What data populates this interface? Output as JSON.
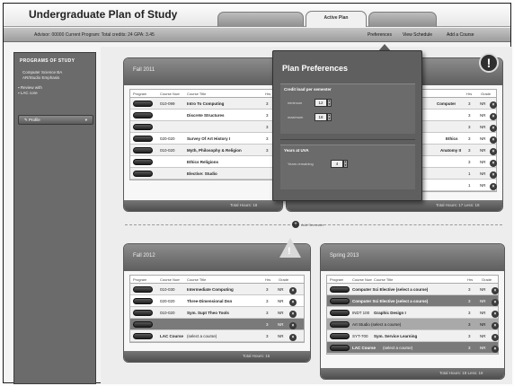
{
  "app": {
    "title": "Undergraduate Plan of Study",
    "tabs": [
      {
        "label": ""
      },
      {
        "label": "Active Plan"
      },
      {
        "label": ""
      }
    ],
    "info": "Advisor: 00000   Current Program: Total credits: 24   GPA: 3.45",
    "nav": {
      "preferences": "Preferences",
      "view_schedule": "View Schedule",
      "add_course": "Add a Course"
    }
  },
  "sidebar": {
    "title": "PROGRAMS OF STUDY",
    "lines": [
      "Computer Science BA",
      "AR/Studio Emphasis"
    ],
    "bullets": [
      "Review with",
      "LAC core"
    ],
    "button_label": "Profile",
    "button_chevron": "▾"
  },
  "panels": {
    "top_left": {
      "name": "Fall 2011",
      "headers": [
        "Program",
        "Course Num",
        "Course Title",
        "Hrs"
      ],
      "rows": [
        {
          "num": "010-099",
          "title": "Intro To Computing",
          "hrs": "3"
        },
        {
          "num": "",
          "title": "Discrete Structures",
          "hrs": "3"
        },
        {
          "num": "",
          "title": "",
          "hrs": "3"
        },
        {
          "num": "020-020",
          "title": "Survey Of Art History I",
          "hrs": "3"
        },
        {
          "num": "010-020",
          "title": "Myth, Philosophy & Religion",
          "hrs": "3"
        },
        {
          "num": "",
          "title": "Ethics Religions",
          "hrs": ""
        },
        {
          "num": "",
          "title": "Elective: Studio",
          "hrs": ""
        }
      ],
      "footer": "Total Hours: 18"
    },
    "top_right": {
      "headers": [
        "Hrs",
        "Grade"
      ],
      "rows": [
        {
          "title": "Computer",
          "hrs": "3",
          "grade": "NR"
        },
        {
          "title": "",
          "hrs": "3",
          "grade": "NR"
        },
        {
          "title": "",
          "hrs": "3",
          "grade": "NR"
        },
        {
          "title": "Ethics",
          "hrs": "3",
          "grade": "NR"
        },
        {
          "title": "Anatomy II",
          "hrs": "3",
          "grade": "NR"
        },
        {
          "title": "",
          "hrs": "3",
          "grade": "NR"
        },
        {
          "title": "",
          "hrs": "1",
          "grade": "NR"
        },
        {
          "title": "",
          "hrs": "1",
          "grade": "NR"
        }
      ],
      "footer": "Total Hours: 17   Less: 18"
    },
    "bottom_left": {
      "name": "Fall 2012",
      "headers": [
        "Program",
        "Course Num",
        "Course Title",
        "Hrs",
        "Grade"
      ],
      "rows": [
        {
          "num": "010-030",
          "title": "Intermediate Computing",
          "hrs": "3",
          "grade": "NR"
        },
        {
          "num": "020-020",
          "title": "Three-Dimensional Dsn",
          "hrs": "3",
          "grade": "NR"
        },
        {
          "num": "010-020",
          "title": "Sym. Supt Theo Tools",
          "hrs": "3",
          "grade": "NR"
        },
        {
          "num": "",
          "title": "",
          "hrs": "3",
          "grade": "NR"
        },
        {
          "num": "LAC Course",
          "title": "(select a course)",
          "hrs": "3",
          "grade": "NR"
        }
      ],
      "footer": "Total Hours: 15"
    },
    "bottom_right": {
      "name": "Spring 2013",
      "headers": [
        "Program",
        "Course Num",
        "Course Title",
        "Hrs",
        "Grade"
      ],
      "rows": [
        {
          "num": "",
          "title": "Computer Sci Elective (select a course)",
          "hrs": "3",
          "grade": "NR"
        },
        {
          "num": "",
          "title": "Computer Sci Elective (select a course)",
          "hrs": "3",
          "grade": "NR"
        },
        {
          "num": "INDT 100",
          "title": "Graphic Design I",
          "hrs": "3",
          "grade": "NR"
        },
        {
          "num": "",
          "title": "Art Studio (select a course)",
          "hrs": "3",
          "grade": "NR"
        },
        {
          "num": "SYT-700",
          "title": "Sym. Service Learning",
          "hrs": "3",
          "grade": "NR"
        },
        {
          "num": "LAC Course",
          "title": "(select a course)",
          "hrs": "3",
          "grade": "NR"
        }
      ],
      "footer": "Total Hours: 18   Less: 18"
    }
  },
  "popover": {
    "title": "Plan Preferences",
    "section1": {
      "title": "Credit load per semester",
      "min_label": "minimum",
      "min_value": "12",
      "max_label": "maximum",
      "max_value": "18"
    },
    "section2": {
      "title": "Years at UVA",
      "label": "Years remaining",
      "value": "4"
    }
  },
  "add_semester_label": "Add Semester",
  "icons": {
    "alert": "!",
    "warning": "!",
    "remove": "×",
    "add": "+"
  }
}
